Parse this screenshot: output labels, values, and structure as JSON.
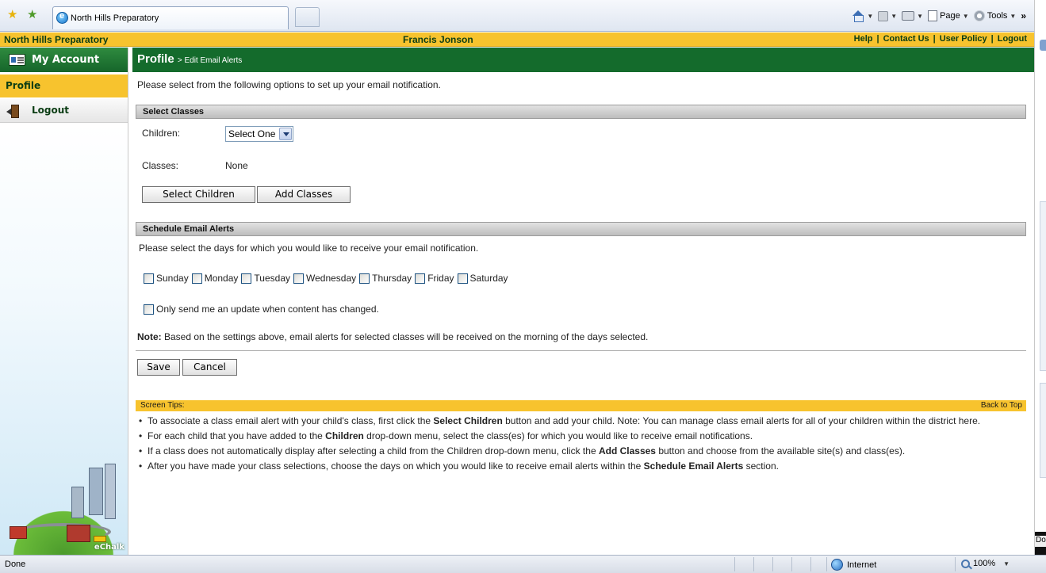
{
  "browser": {
    "tab_title": "North Hills Preparatory",
    "commands": {
      "page": "Page",
      "tools": "Tools"
    },
    "more": "»"
  },
  "header": {
    "school": "North Hills Preparatory",
    "user": "Francis Jonson",
    "links": [
      "Help",
      "Contact Us",
      "User Policy",
      "Logout"
    ]
  },
  "sidebar": {
    "account": "My Account",
    "profile": "Profile",
    "logout": "Logout",
    "brand": "eChalk"
  },
  "main": {
    "title": "Profile",
    "subtitle": "> Edit Email Alerts",
    "intro": "Please select from the following options to set up your email notification.",
    "select_classes": {
      "heading": "Select Classes",
      "children_label": "Children:",
      "children_value": "Select One",
      "classes_label": "Classes:",
      "classes_value": "None",
      "btn_select_children": "Select Children",
      "btn_add_classes": "Add Classes"
    },
    "schedule": {
      "heading": "Schedule Email Alerts",
      "instructions": "Please select the days for which you would like to receive your email notification.",
      "days": [
        "Sunday",
        "Monday",
        "Tuesday",
        "Wednesday",
        "Thursday",
        "Friday",
        "Saturday"
      ],
      "only_update": "Only send me an update when content has changed."
    },
    "note_label": "Note:",
    "note_text": " Based on the settings above, email alerts for selected classes will be received on the morning of the days selected.",
    "save": "Save",
    "cancel": "Cancel",
    "tips_title": "Screen Tips:",
    "back_to_top": "Back to Top",
    "tips": [
      [
        "To associate a class email alert with your child's class, first click the ",
        "Select Children",
        " button and add your child. Note: You can manage class email alerts for all of your children within the district here."
      ],
      [
        "For each child that you have added to the ",
        "Children",
        " drop-down menu, select the class(es) for which you would like to receive email notifications."
      ],
      [
        "If a class does not automatically display after selecting a child from the Children drop-down menu, click the ",
        "Add Classes",
        " button and choose from the available site(s) and class(es)."
      ],
      [
        "After you have made your class selections, choose the days on which you would like to receive email alerts within the ",
        "Schedule Email Alerts",
        " section."
      ]
    ]
  },
  "status": {
    "text": "Done",
    "zone": "Internet",
    "zoom": "100%",
    "right_fragment": "Dor"
  }
}
